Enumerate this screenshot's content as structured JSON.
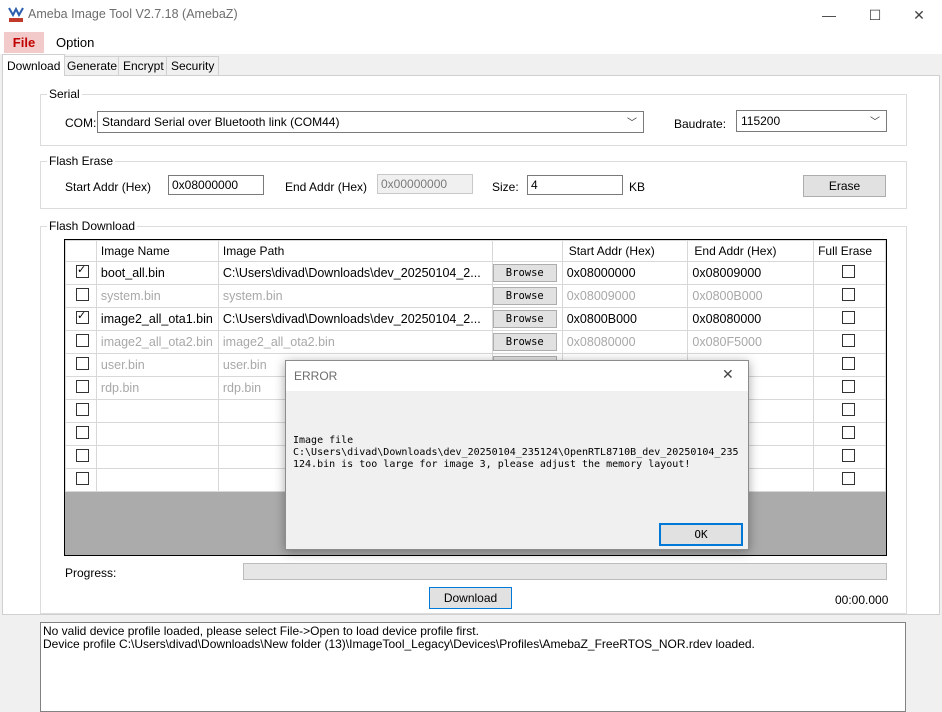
{
  "window": {
    "title": "Ameba Image Tool V2.7.18 (AmebaZ)",
    "controls": {
      "minimize": "—",
      "maximize": "☐",
      "close": "✕"
    }
  },
  "menu": {
    "file": "File",
    "option": "Option"
  },
  "tabs": [
    "Download",
    "Generate",
    "Encrypt",
    "Security"
  ],
  "serial": {
    "group_label": "Serial",
    "com_label": "COM:",
    "com_value": "Standard Serial over Bluetooth link (COM44)",
    "baud_label": "Baudrate:",
    "baud_value": "115200"
  },
  "flash_erase": {
    "group_label": "Flash Erase",
    "start_label": "Start Addr (Hex)",
    "start_value": "0x08000000",
    "end_label": "End Addr (Hex)",
    "end_value": "0x00000000",
    "size_label": "Size:",
    "size_value": "4",
    "size_unit": "KB",
    "erase_button": "Erase"
  },
  "flash_download": {
    "group_label": "Flash Download",
    "columns": [
      "",
      "Image Name",
      "Image Path",
      "",
      "Start Addr (Hex)",
      "End Addr (Hex)",
      "Full Erase"
    ],
    "browse_label": "Browse",
    "rows": [
      {
        "checked": true,
        "enabled": true,
        "name": "boot_all.bin",
        "path": "C:\\Users\\divad\\Downloads\\dev_20250104_2...",
        "start": "0x08000000",
        "end": "0x08009000"
      },
      {
        "checked": false,
        "enabled": false,
        "name": "system.bin",
        "path": "system.bin",
        "start": "0x08009000",
        "end": "0x0800B000"
      },
      {
        "checked": true,
        "enabled": true,
        "name": "image2_all_ota1.bin",
        "path": "C:\\Users\\divad\\Downloads\\dev_20250104_2...",
        "start": "0x0800B000",
        "end": "0x08080000"
      },
      {
        "checked": false,
        "enabled": false,
        "name": "image2_all_ota2.bin",
        "path": "image2_all_ota2.bin",
        "start": "0x08080000",
        "end": "0x080F5000"
      },
      {
        "checked": false,
        "enabled": false,
        "name": "user.bin",
        "path": "user.bin",
        "start": "",
        "end": "00"
      },
      {
        "checked": false,
        "enabled": false,
        "name": "rdp.bin",
        "path": "rdp.bin",
        "start": "",
        "end": "00"
      },
      {
        "checked": false,
        "enabled": false,
        "name": "",
        "path": "",
        "start": "",
        "end": ""
      },
      {
        "checked": false,
        "enabled": false,
        "name": "",
        "path": "",
        "start": "",
        "end": ""
      },
      {
        "checked": false,
        "enabled": false,
        "name": "",
        "path": "",
        "start": "",
        "end": ""
      },
      {
        "checked": false,
        "enabled": false,
        "name": "",
        "path": "",
        "start": "",
        "end": ""
      }
    ],
    "progress_label": "Progress:",
    "progress_value": 0,
    "download_button": "Download",
    "elapsed": "00:00.000"
  },
  "log": [
    "No valid device profile loaded, please select File->Open to load device profile first.",
    "Device profile C:\\Users\\divad\\Downloads\\New folder (13)\\ImageTool_Legacy\\Devices\\Profiles\\AmebaZ_FreeRTOS_NOR.rdev loaded."
  ],
  "dialog": {
    "title": "ERROR",
    "close": "✕",
    "message": "Image file\nC:\\Users\\divad\\Downloads\\dev_20250104_235124\\OpenRTL8710B_dev_20250104_235\n124.bin is too large for image 3, please adjust the memory layout!",
    "ok_button": "OK"
  }
}
